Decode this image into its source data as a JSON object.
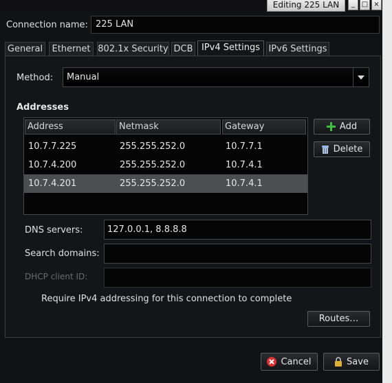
{
  "window": {
    "title": "Editing 225 LAN",
    "controls": {
      "minimize": "_",
      "maximize": "□",
      "close": "×"
    }
  },
  "connection": {
    "label": "Connection name:",
    "value": "225 LAN"
  },
  "tabs": [
    {
      "label": "General"
    },
    {
      "label": "Ethernet"
    },
    {
      "label": "802.1x Security"
    },
    {
      "label": "DCB"
    },
    {
      "label": "IPv4 Settings",
      "active": true
    },
    {
      "label": "IPv6 Settings"
    }
  ],
  "method": {
    "label": "Method:",
    "value": "Manual"
  },
  "addresses": {
    "heading": "Addresses",
    "columns": [
      "Address",
      "Netmask",
      "Gateway"
    ],
    "rows": [
      [
        "10.7.7.225",
        "255.255.252.0",
        "10.7.7.1"
      ],
      [
        "10.7.4.200",
        "255.255.252.0",
        "10.7.4.1"
      ],
      [
        "10.7.4.201",
        "255.255.252.0",
        "10.7.4.1"
      ]
    ],
    "selected_row": 2,
    "add_label": "Add",
    "delete_label": "Delete"
  },
  "dns": {
    "label": "DNS servers:",
    "value": "127.0.0.1, 8.8.8.8"
  },
  "search_domains": {
    "label": "Search domains:",
    "value": ""
  },
  "dhcp_client_id": {
    "label": "DHCP client ID:",
    "value": ""
  },
  "require_ipv4": {
    "label": "Require IPv4 addressing for this connection to complete"
  },
  "routes_label": "Routes…",
  "cancel_label": "Cancel",
  "save_label": "Save",
  "colors": {
    "add_icon": "#3fbf3f",
    "cancel_icon": "#d93030",
    "save_icon": "#e0b030",
    "selected_row": "#4d4e52"
  }
}
